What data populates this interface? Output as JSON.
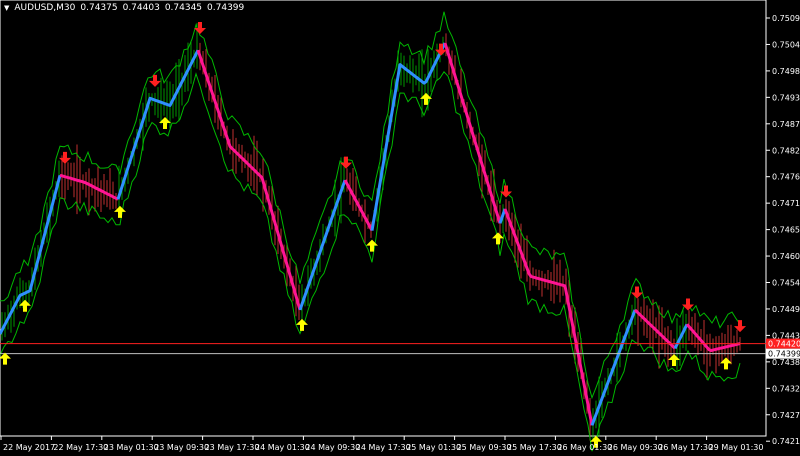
{
  "window": {
    "symbol_timeframe": "AUDUSD,M30",
    "ohlc_values": [
      "0.74375",
      "0.74403",
      "0.74345",
      "0.74399"
    ],
    "menu_icon": "triangle-down-icon"
  },
  "colors": {
    "background": "#000000",
    "frame": "#ffffff",
    "candle_wick_up": "#00cc00",
    "candle_wick_down": "#ff4040",
    "envelope": "#00b800",
    "trend_up": "#2f8fff",
    "trend_down": "#ff1493",
    "buy_arrow": "#ffff00",
    "sell_arrow": "#ff2020",
    "bid_line": "#ff2020",
    "ask_line": "#c0c0c0"
  },
  "price_axis": {
    "labels": [
      "0.75097",
      "0.75042",
      "0.74987",
      "0.74932",
      "0.74877",
      "0.74822",
      "0.74767",
      "0.74712",
      "0.74657",
      "0.74602",
      "0.74547",
      "0.74492",
      "0.74437",
      "0.74382",
      "0.74327",
      "0.74272",
      "0.74217"
    ],
    "ask_price": "0.74399",
    "bid_price": "0.74420"
  },
  "time_axis": {
    "labels": [
      "22 May 2017",
      "22 May 17:30",
      "23 May 01:30",
      "23 May 09:30",
      "23 May 17:30",
      "24 May 01:30",
      "24 May 09:30",
      "24 May 17:30",
      "25 May 01:30",
      "25 May 09:30",
      "25 May 17:30",
      "26 May 01:30",
      "26 May 09:30",
      "26 May 17:30",
      "29 May 01:30"
    ]
  },
  "chart_data": {
    "type": "line",
    "instrument": "AUDUSD",
    "timeframe": "M30",
    "ylim": [
      0.74217,
      0.75125
    ],
    "trend_line": [
      {
        "t": 0,
        "y": 0.7444
      },
      {
        "t": 20,
        "y": 0.7452
      },
      {
        "t": 30,
        "y": 0.7453
      },
      {
        "t": 60,
        "y": 0.7477
      },
      {
        "t": 85,
        "y": 0.74755
      },
      {
        "t": 118,
        "y": 0.7472
      },
      {
        "t": 150,
        "y": 0.7493
      },
      {
        "t": 170,
        "y": 0.74915
      },
      {
        "t": 198,
        "y": 0.7503
      },
      {
        "t": 230,
        "y": 0.7483
      },
      {
        "t": 262,
        "y": 0.74765
      },
      {
        "t": 300,
        "y": 0.7449
      },
      {
        "t": 345,
        "y": 0.7476
      },
      {
        "t": 372,
        "y": 0.74655
      },
      {
        "t": 400,
        "y": 0.75
      },
      {
        "t": 425,
        "y": 0.7496
      },
      {
        "t": 445,
        "y": 0.75045
      },
      {
        "t": 500,
        "y": 0.7467
      },
      {
        "t": 505,
        "y": 0.747
      },
      {
        "t": 530,
        "y": 0.7456
      },
      {
        "t": 565,
        "y": 0.7454
      },
      {
        "t": 592,
        "y": 0.7425
      },
      {
        "t": 635,
        "y": 0.7449
      },
      {
        "t": 675,
        "y": 0.7441
      },
      {
        "t": 687,
        "y": 0.7446
      },
      {
        "t": 710,
        "y": 0.74405
      },
      {
        "t": 740,
        "y": 0.7442
      }
    ],
    "trend_segments": [
      {
        "from": 0,
        "to": 60,
        "dir": "up"
      },
      {
        "from": 60,
        "to": 118,
        "dir": "down"
      },
      {
        "from": 118,
        "to": 198,
        "dir": "up"
      },
      {
        "from": 198,
        "to": 300,
        "dir": "down"
      },
      {
        "from": 300,
        "to": 345,
        "dir": "up"
      },
      {
        "from": 345,
        "to": 372,
        "dir": "down"
      },
      {
        "from": 372,
        "to": 445,
        "dir": "up"
      },
      {
        "from": 445,
        "to": 500,
        "dir": "down"
      },
      {
        "from": 500,
        "to": 505,
        "dir": "up"
      },
      {
        "from": 505,
        "to": 592,
        "dir": "down"
      },
      {
        "from": 592,
        "to": 635,
        "dir": "up"
      },
      {
        "from": 635,
        "to": 675,
        "dir": "down"
      },
      {
        "from": 675,
        "to": 687,
        "dir": "up"
      },
      {
        "from": 687,
        "to": 740,
        "dir": "down"
      }
    ],
    "sell_signals": [
      {
        "t": 65,
        "y": 0.748
      },
      {
        "t": 155,
        "y": 0.7496
      },
      {
        "t": 200,
        "y": 0.7507
      },
      {
        "t": 346,
        "y": 0.7479
      },
      {
        "t": 441,
        "y": 0.75025
      },
      {
        "t": 506,
        "y": 0.7473
      },
      {
        "t": 637,
        "y": 0.7452
      },
      {
        "t": 688,
        "y": 0.74495
      },
      {
        "t": 740,
        "y": 0.7445
      }
    ],
    "buy_signals": [
      {
        "t": 5,
        "y": 0.74395
      },
      {
        "t": 25,
        "y": 0.74505
      },
      {
        "t": 120,
        "y": 0.747
      },
      {
        "t": 165,
        "y": 0.74885
      },
      {
        "t": 302,
        "y": 0.74465
      },
      {
        "t": 372,
        "y": 0.7463
      },
      {
        "t": 426,
        "y": 0.74935
      },
      {
        "t": 498,
        "y": 0.74645
      },
      {
        "t": 596,
        "y": 0.74222
      },
      {
        "t": 674,
        "y": 0.74392
      },
      {
        "t": 726,
        "y": 0.74385
      }
    ]
  }
}
